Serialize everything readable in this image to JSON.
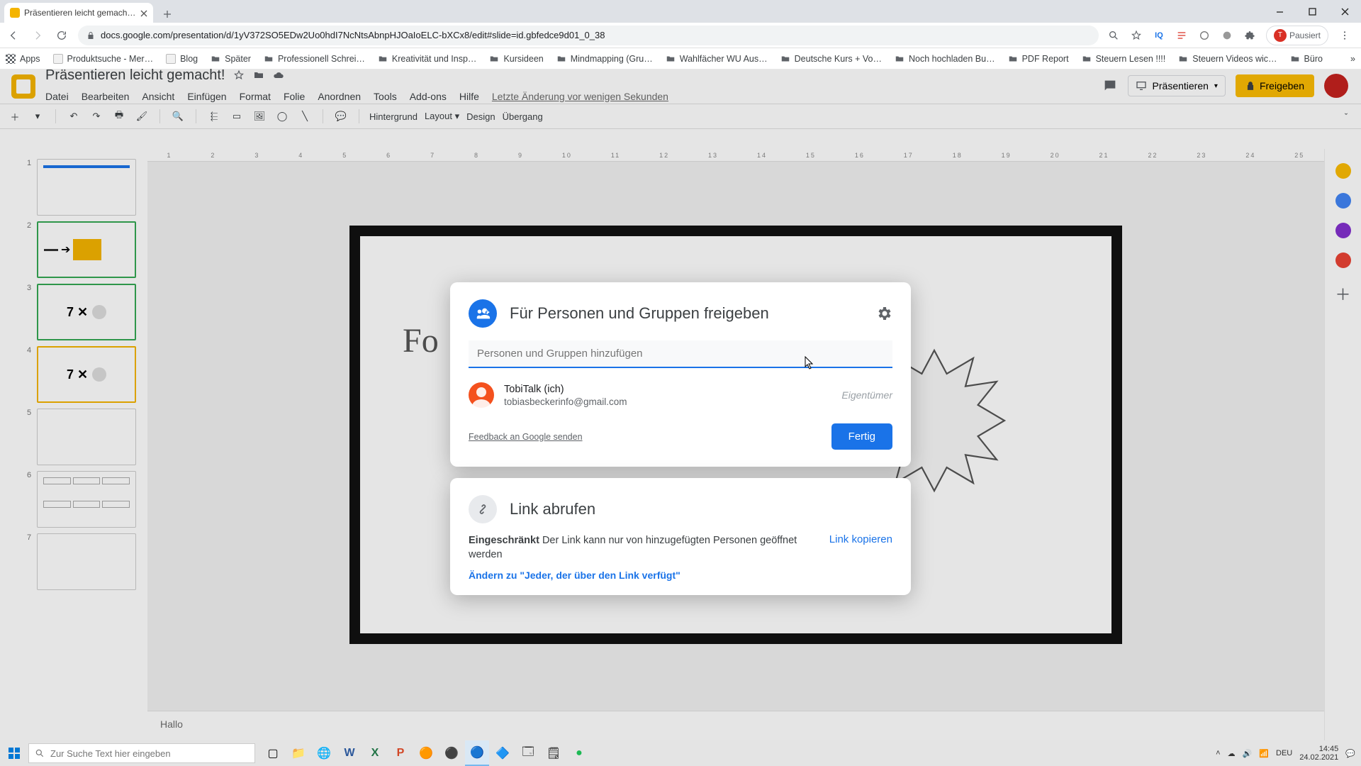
{
  "browser": {
    "tab_title": "Präsentieren leicht gemacht! - G…",
    "url": "docs.google.com/presentation/d/1yV372SO5EDw2Uo0hdI7NcNtsAbnpHJOaIoELC-bXCx8/edit#slide=id.gbfedce9d01_0_38",
    "profile_label": "Pausiert",
    "profile_initial": "T"
  },
  "bookmarks": {
    "apps": "Apps",
    "items": [
      "Produktsuche - Mer…",
      "Blog",
      "Später",
      "Professionell Schrei…",
      "Kreativität und Insp…",
      "Kursideen",
      "Mindmapping  (Gru…",
      "Wahlfächer WU Aus…",
      "Deutsche Kurs + Vo…",
      "Noch hochladen Bu…",
      "PDF Report",
      "Steuern Lesen !!!!",
      "Steuern Videos wic…",
      "Büro"
    ]
  },
  "slides": {
    "doc_title": "Präsentieren leicht gemacht!",
    "menus": [
      "Datei",
      "Bearbeiten",
      "Ansicht",
      "Einfügen",
      "Format",
      "Folie",
      "Anordnen",
      "Tools",
      "Add-ons",
      "Hilfe"
    ],
    "last_edit": "Letzte Änderung vor wenigen Sekunden",
    "present": "Präsentieren",
    "share_top": "Freigeben",
    "toolbar": {
      "background": "Hintergrund",
      "layout": "Layout",
      "design": "Design",
      "transition": "Übergang"
    },
    "ruler": [
      "1",
      "2",
      "3",
      "4",
      "5",
      "6",
      "7",
      "8",
      "9",
      "10",
      "11",
      "12",
      "13",
      "14",
      "15",
      "16",
      "17",
      "18",
      "19",
      "20",
      "21",
      "22",
      "23",
      "24",
      "25"
    ],
    "thumbs": [
      "1",
      "2",
      "3",
      "4",
      "5",
      "6",
      "7"
    ],
    "slide_text": "Fo",
    "thumb3_text": "7 ✕",
    "thumb4_text": "7 ✕",
    "notes": "Hallo"
  },
  "share": {
    "title": "Für Personen und Gruppen freigeben",
    "input_placeholder": "Personen und Gruppen hinzufügen",
    "person_name": "TobiTalk (ich)",
    "person_email": "tobiasbeckerinfo@gmail.com",
    "role": "Eigentümer",
    "feedback": "Feedback an Google senden",
    "done": "Fertig",
    "link_title": "Link abrufen",
    "restricted": "Eingeschränkt",
    "restricted_desc": " Der Link kann nur von hinzugefügten Personen geöffnet werden",
    "copy": "Link kopieren",
    "change": "Ändern zu \"Jeder, der über den Link verfügt\""
  },
  "taskbar": {
    "search_placeholder": "Zur Suche Text hier eingeben",
    "lang": "DEU",
    "time": "14:45",
    "date": "24.02.2021"
  }
}
